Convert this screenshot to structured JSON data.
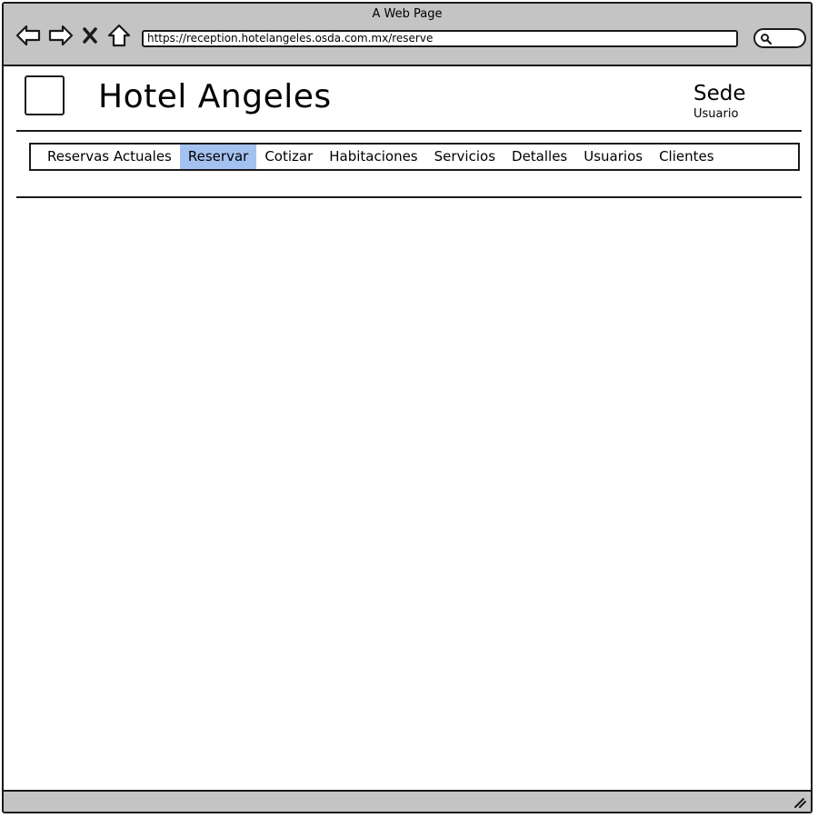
{
  "window": {
    "title": "A Web Page"
  },
  "browser": {
    "url": "https://reception.hotelangeles.osda.com.mx/reserve",
    "buttons": {
      "back": "back-arrow-icon",
      "forward": "forward-arrow-icon",
      "stop": "close-icon",
      "home": "home-icon",
      "search": "search-icon"
    }
  },
  "header": {
    "title": "Hotel Angeles",
    "sede": "Sede",
    "usuario": "Usuario"
  },
  "tabs": [
    {
      "label": "Reservas Actuales",
      "active": false
    },
    {
      "label": "Reservar",
      "active": true
    },
    {
      "label": "Cotizar",
      "active": false
    },
    {
      "label": "Habitaciones",
      "active": false
    },
    {
      "label": "Servicios",
      "active": false
    },
    {
      "label": "Detalles",
      "active": false
    },
    {
      "label": "Usuarios",
      "active": false
    },
    {
      "label": "Clientes",
      "active": false
    }
  ],
  "colors": {
    "active_tab": "#a3c2f0",
    "chrome": "#c4c4c4",
    "stroke": "#1a1a1a"
  }
}
